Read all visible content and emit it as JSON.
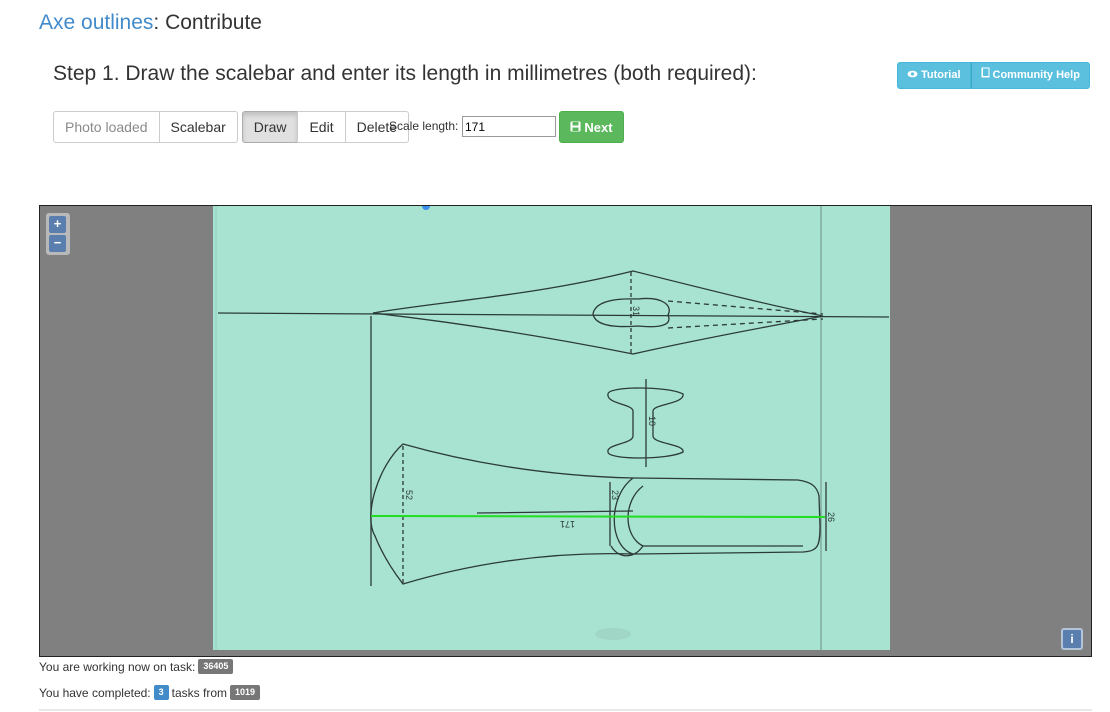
{
  "header": {
    "link_text": "Axe outlines",
    "title_suffix": ": Contribute"
  },
  "step": {
    "title": "Step 1. Draw the scalebar and enter its length in millimetres (both required):"
  },
  "help": {
    "tutorial_label": "Tutorial",
    "community_label": "Community Help"
  },
  "toolbar": {
    "photo_loaded": "Photo loaded",
    "scalebar": "Scalebar",
    "draw": "Draw",
    "edit": "Edit",
    "delete": "Delete",
    "scale_length_label": "Scale length:",
    "scale_length_value": "171",
    "next": "Next"
  },
  "viewer": {
    "zoom_in": "+",
    "zoom_out": "−",
    "info": "i",
    "drawing_labels": {
      "dim_31": "31",
      "dim_10": "10",
      "dim_52": "52",
      "dim_23": "23",
      "dim_171": "171",
      "dim_26": "26"
    }
  },
  "status": {
    "working_text": "You are working now on task:",
    "task_id": "36405",
    "completed_prefix": "You have completed:",
    "completed_count": "3",
    "tasks_from": "tasks from",
    "total_tasks": "1019"
  },
  "colors": {
    "link": "#428bca",
    "info_btn": "#5bc0de",
    "success": "#5cb85c",
    "paper": "#a7e3d0",
    "scalebar_line": "#22dd22"
  }
}
